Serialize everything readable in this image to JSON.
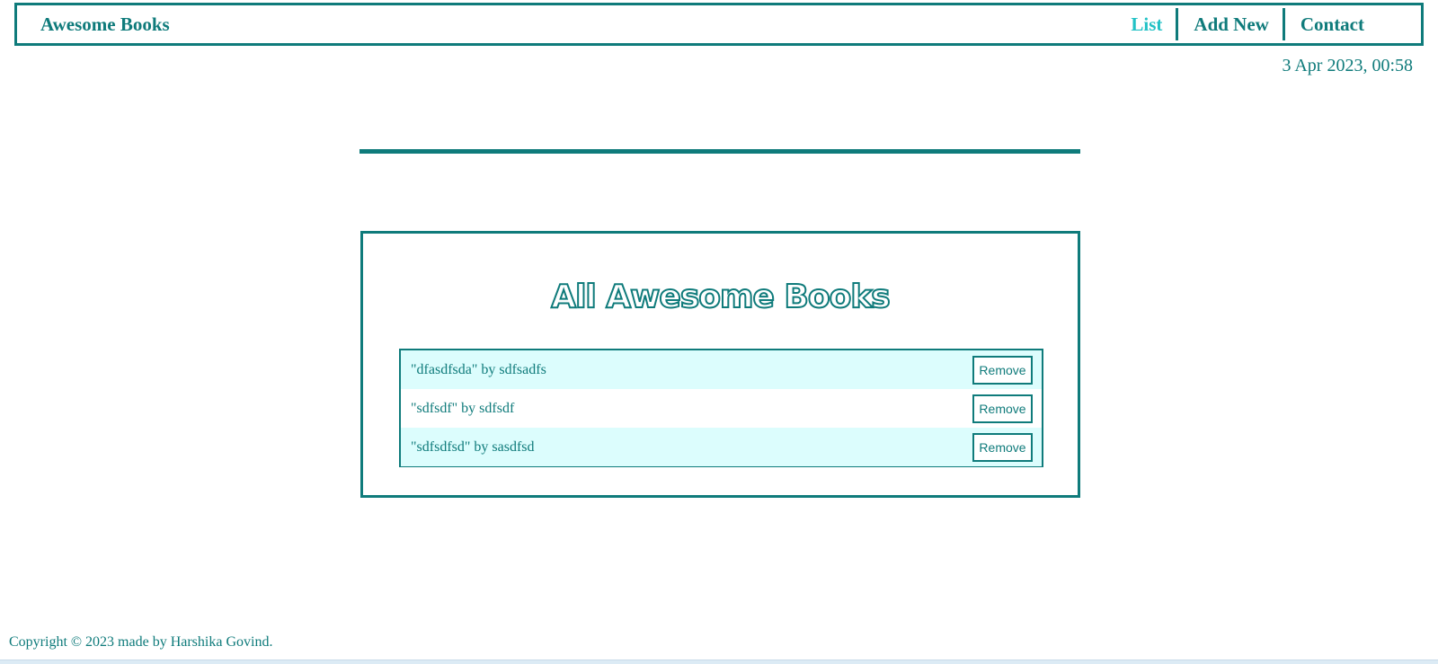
{
  "nav": {
    "brand": "Awesome Books",
    "links": [
      {
        "label": "List",
        "active": true
      },
      {
        "label": "Add New",
        "active": false
      },
      {
        "label": "Contact",
        "active": false
      }
    ]
  },
  "datetime": "3 Apr 2023, 00:58",
  "books_section": {
    "title": "All Awesome Books",
    "books": [
      {
        "text": "\"dfasdfsda\" by sdfsadfs",
        "remove_label": "Remove"
      },
      {
        "text": "\"sdfsdf\" by sdfsdf",
        "remove_label": "Remove"
      },
      {
        "text": "\"sdfsdfsd\" by sasdfsd",
        "remove_label": "Remove"
      }
    ]
  },
  "footer": {
    "copyright": "Copyright © 2023 made by Harshika Govind."
  },
  "colors": {
    "primary": "#0f7b7b",
    "active_link": "#21c1c5",
    "row_highlight": "#dcfdfd"
  }
}
